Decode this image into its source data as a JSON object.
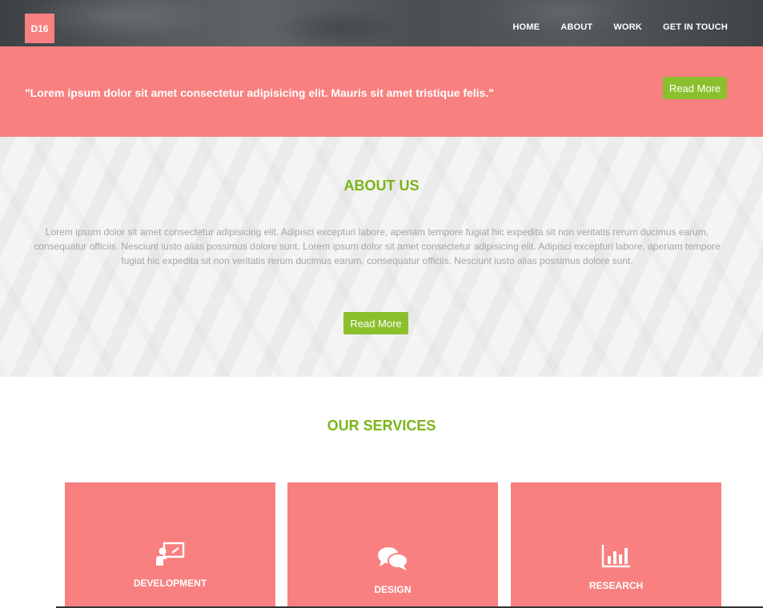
{
  "header": {
    "logo": "D16",
    "nav": [
      "HOME",
      "ABOUT",
      "WORK",
      "GET IN TOUCH"
    ]
  },
  "banner": {
    "quote": "\"Lorem ipsum dolor sit amet consectetur adipisicing elit. Mauris sit amet tristique felis.\"",
    "button_label": "Read More"
  },
  "about": {
    "title": "ABOUT US",
    "text": "Lorem ipsum dolor sit amet consectetur adipisicing elit. Adipisci excepturi labore, aperiam tempore fugiat hic expedita sit non veritatis rerum ducimus earum, consequatur officiis. Nesciunt iusto alias possimus dolore sunt. Lorem ipsum dolor sit amet consectetur adipisicing elit. Adipisci excepturi labore, aperiam tempore fugiat hic expedita sit non veritatis rerum ducimus earum, consequatur officiis. Nesciunt iusto alias possimus dolore sunt.",
    "button_label": "Read More"
  },
  "services": {
    "title": "OUR SERVICES",
    "cards": [
      {
        "label": "DEVELOPMENT",
        "icon": "presentation-icon"
      },
      {
        "label": "DESIGN",
        "icon": "chat-bubbles-icon"
      },
      {
        "label": "RESEARCH",
        "icon": "bar-chart-icon"
      }
    ]
  },
  "colors": {
    "accent_pink": "#f98080",
    "accent_green": "#8bc02c",
    "title_green": "#7cb518"
  }
}
